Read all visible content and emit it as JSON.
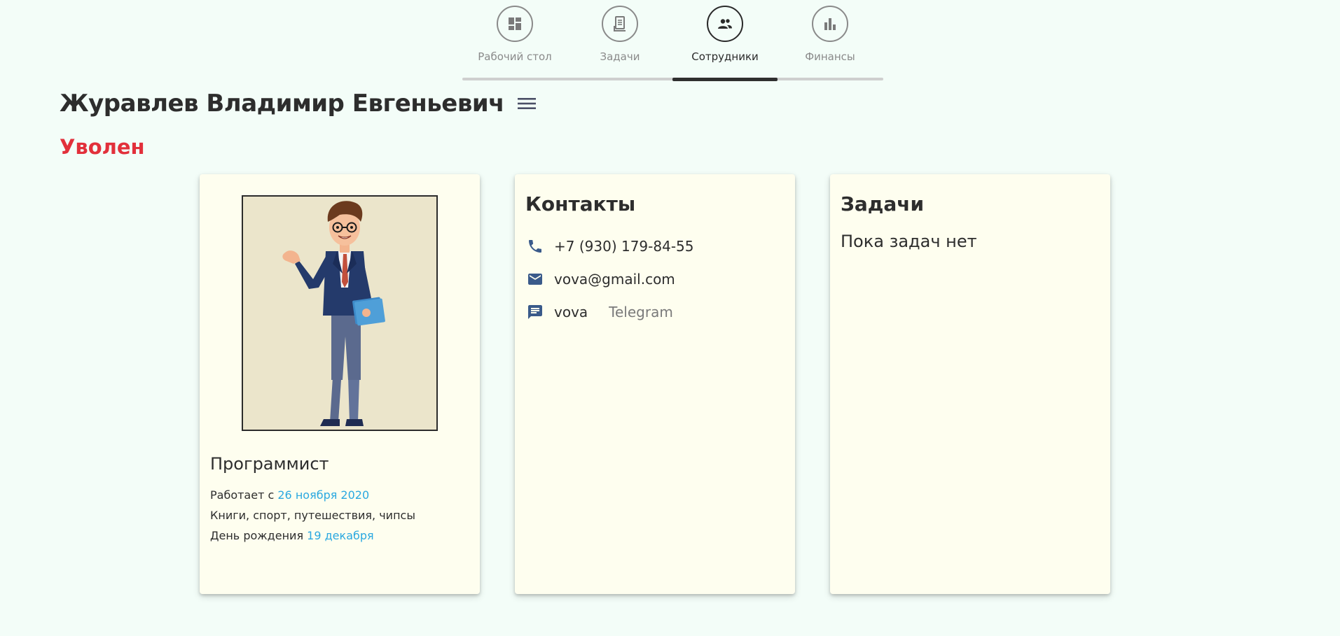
{
  "nav": {
    "items": [
      {
        "label": "Рабочий стол",
        "icon": "dashboard-icon",
        "active": false
      },
      {
        "label": "Задачи",
        "icon": "document-icon",
        "active": false
      },
      {
        "label": "Сотрудники",
        "icon": "people-icon",
        "active": true
      },
      {
        "label": "Финансы",
        "icon": "bar-chart-icon",
        "active": false
      }
    ]
  },
  "header": {
    "name": "Журавлев Владимир Евгеньевич",
    "menu_icon": "hamburger-menu-icon",
    "status": "Уволен"
  },
  "colors": {
    "background": "#f3fdf8",
    "card": "#fefeef",
    "status": "#e2303b",
    "link": "#2aa8e0",
    "icon": "#3a5a8a"
  },
  "profile": {
    "position": "Программист",
    "works_since_label": "Работает с",
    "works_since_date": "26 ноября 2020",
    "hobbies": "Книги, спорт, путешествия, чипсы",
    "birthday_label": "День рождения",
    "birthday_date": "19 декабря"
  },
  "contacts": {
    "title": "Контакты",
    "phone": "+7 (930) 179-84-55",
    "email": "vova@gmail.com",
    "messenger_user": "vova",
    "messenger_name": "Telegram"
  },
  "tasks": {
    "title": "Задачи",
    "empty_text": "Пока задач нет"
  }
}
